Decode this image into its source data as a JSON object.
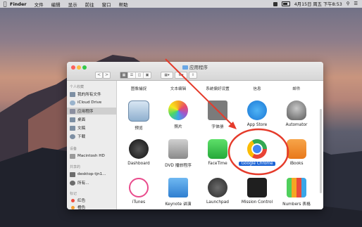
{
  "menubar": {
    "app_name": "Finder",
    "items": [
      "文件",
      "编辑",
      "显示",
      "前往",
      "窗口",
      "帮助"
    ],
    "date_time": "4月15日 周五 下午8:53"
  },
  "window": {
    "title": "应用程序",
    "nav_back": "<",
    "nav_forward": ">"
  },
  "sidebar": {
    "favorites_header": "个人收藏",
    "items": [
      "我的所有文件",
      "iCloud Drive",
      "应用程序",
      "桌面",
      "文稿",
      "下载"
    ],
    "devices_header": "设备",
    "devices": [
      "Macintosh HD"
    ],
    "shared_header": "共享的",
    "shared": [
      "desktop-tjn1...",
      "所有..."
    ],
    "tags_header": "标记",
    "tags": [
      {
        "label": "红色",
        "color": "#ee4b3e"
      },
      {
        "label": "橙色",
        "color": "#f6a032"
      }
    ]
  },
  "content": {
    "top_row": [
      "图像捕捉",
      "文本编辑",
      "系统偏好设置",
      "信息",
      "邮件"
    ],
    "apps": [
      {
        "label": "预览",
        "icon": "preview-icon"
      },
      {
        "label": "照片",
        "icon": "photos-icon"
      },
      {
        "label": "字体册",
        "icon": "font-book-icon"
      },
      {
        "label": "App Store",
        "icon": "app-store-icon"
      },
      {
        "label": "Automator",
        "icon": "automator-icon"
      },
      {
        "label": "Dashboard",
        "icon": "dashboard-icon"
      },
      {
        "label": "DVD 播放程序",
        "icon": "dvd-player-icon"
      },
      {
        "label": "FaceTime",
        "icon": "facetime-icon"
      },
      {
        "label": "Google Chrome",
        "icon": "chrome-icon",
        "selected": true
      },
      {
        "label": "iBooks",
        "icon": "ibooks-icon"
      },
      {
        "label": "iTunes",
        "icon": "itunes-icon"
      },
      {
        "label": "Keynote 讲演",
        "icon": "keynote-icon"
      },
      {
        "label": "Launchpad",
        "icon": "launchpad-icon"
      },
      {
        "label": "Mission Control",
        "icon": "mission-control-icon"
      },
      {
        "label": "Numbers 表格",
        "icon": "numbers-icon"
      }
    ]
  },
  "colors": {
    "selection": "#1b64d6",
    "annotation": "#e53b2b"
  }
}
